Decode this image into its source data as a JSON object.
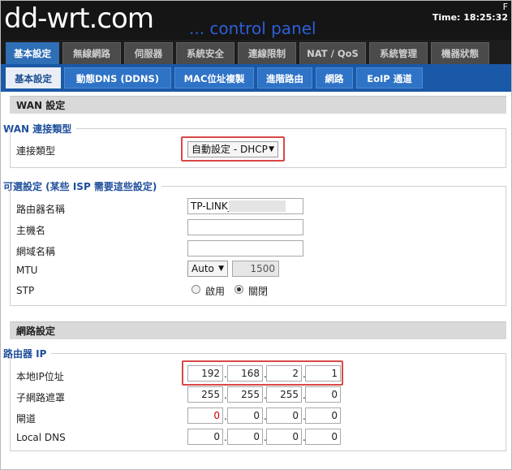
{
  "header": {
    "logo": "dd-wrt.com",
    "subtitle": "... control panel",
    "corner_letter": "F",
    "clock": "Time: 18:25:32"
  },
  "top_tabs": [
    "基本設定",
    "無線網路",
    "伺服器",
    "系統安全",
    "連線限制",
    "NAT / QoS",
    "系統管理",
    "機器狀態"
  ],
  "sub_tabs": [
    "基本設定",
    "動態DNS (DDNS)",
    "MAC位址複製",
    "進階路由",
    "網路",
    "EoIP 通道"
  ],
  "wan_section": {
    "title": "WAN 設定",
    "conn_legend": "WAN 連接類型",
    "conn_label": "連接類型",
    "conn_value": "自動設定 - DHCP",
    "optional_legend": "可選設定 (某些 ISP 需要這些設定)",
    "router_name_label": "路由器名稱",
    "router_name_value": "TP-LINK_",
    "hostname_label": "主機名",
    "hostname_value": "",
    "domain_label": "網域名稱",
    "domain_value": "",
    "mtu_label": "MTU",
    "mtu_mode": "Auto",
    "mtu_value": "1500",
    "stp_label": "STP",
    "stp_enable": "啟用",
    "stp_disable": "關閉",
    "stp_selected": "disable"
  },
  "network_section": {
    "title": "網路設定",
    "router_ip_legend": "路由器 IP",
    "local_ip_label": "本地IP位址",
    "local_ip": [
      "192",
      "168",
      "2",
      "1"
    ],
    "subnet_label": "子網路遮罩",
    "subnet": [
      "255",
      "255",
      "255",
      "0"
    ],
    "gateway_label": "閘道",
    "gateway": [
      "0",
      "0",
      "0",
      "0"
    ],
    "dns_label": "Local DNS",
    "dns": [
      "0",
      "0",
      "0",
      "0"
    ]
  },
  "colors": {
    "highlight": "#d84848",
    "legend_blue": "#1f4f9b",
    "active_tab": "#2f6fb6"
  }
}
